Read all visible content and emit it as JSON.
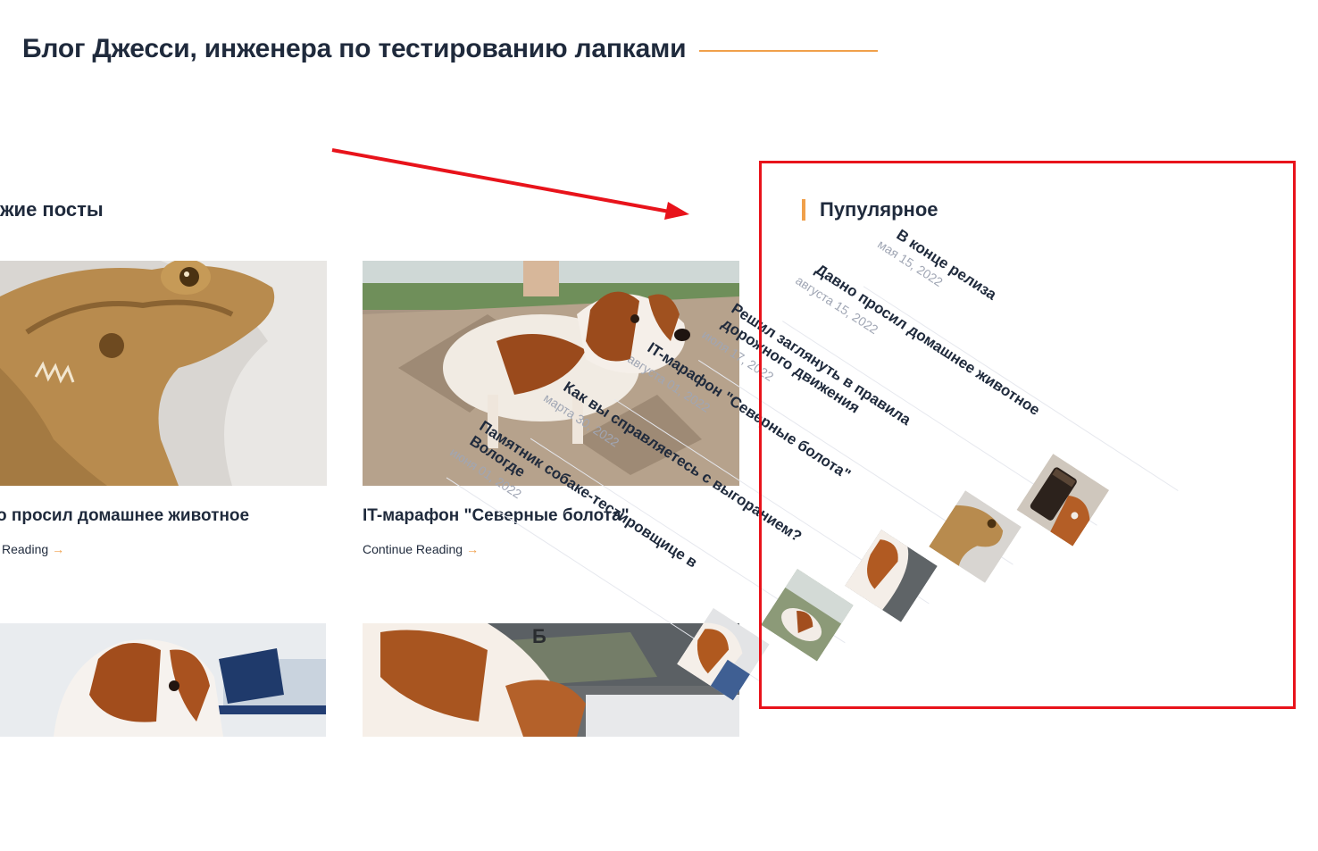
{
  "header": {
    "title": "Блог Джесси, инженера по тестированию лапками",
    "accent_color": "#f0a04b"
  },
  "recent": {
    "heading": "ежие посты",
    "posts": [
      {
        "title": "о просил домашнее животное",
        "link": "Reading",
        "image": "bearded-dragon-photo"
      },
      {
        "title": "IT-марафон \"Северные болота\"",
        "link": "Continue Reading",
        "image": "spaniel-on-sand-photo"
      },
      {
        "title": "",
        "link": "",
        "image": "spaniel-at-desk-photo"
      },
      {
        "title": "",
        "link": "",
        "image": "spaniel-in-car-photo"
      }
    ]
  },
  "popular": {
    "heading": "Пупулярное",
    "items": [
      {
        "title": "В конце релиза",
        "date": "мая 15, 2022"
      },
      {
        "title": "Давно просил домашнее животное",
        "date": "августа 15, 2022",
        "thumb": "coffee-and-dog-thumb"
      },
      {
        "title": "Решил заглянуть в правила дорожного движения",
        "date": "июля 17, 2022",
        "thumb": "lizard-thumb"
      },
      {
        "title": "IT-марафон \"Северные болота\"",
        "date": "августа 01, 2022",
        "thumb": "spaniel-car-thumb"
      },
      {
        "title": "Как вы справляетесь с выгоранием?",
        "date": "марта 30, 2022",
        "thumb": "spaniel-park-thumb"
      },
      {
        "title": "Памятник собаке-тестировщице в Вологде",
        "date": "июня 01, 2022",
        "thumb": "spaniel-hands-thumb"
      }
    ]
  },
  "annotation": {
    "color": "#e8131b"
  }
}
